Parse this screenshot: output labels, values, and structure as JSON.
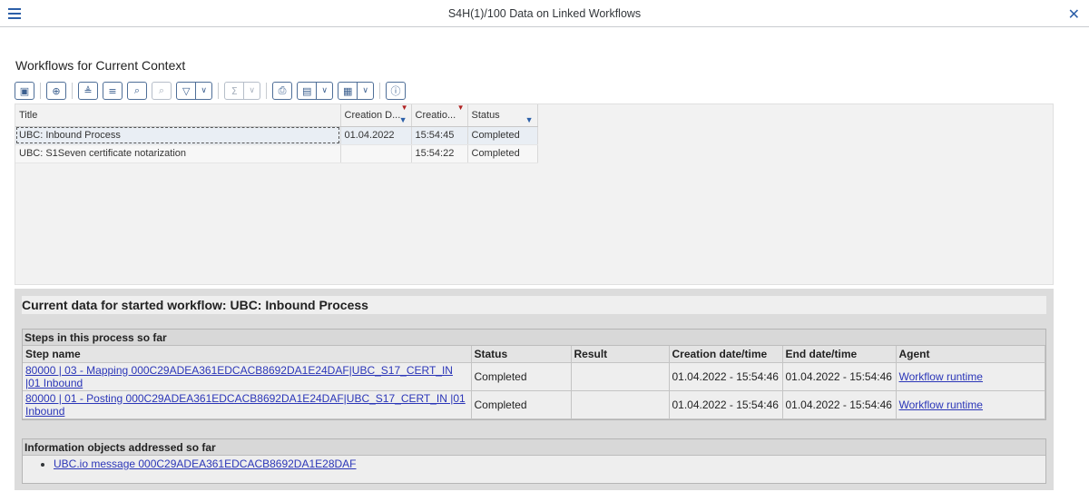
{
  "window": {
    "title": "S4H(1)/100 Data on Linked Workflows",
    "close_glyph": "✕"
  },
  "workflows": {
    "section_title": "Workflows for Current Context",
    "toolbar": {
      "buttons": [
        "details-icon",
        "zoom-icon",
        "sort-ascending-icon",
        "sort-descending-icon",
        "find-icon",
        "find-next-icon",
        "filter-icon",
        "sum-icon",
        "print-icon",
        "export-icon",
        "layout-icon",
        "info-icon"
      ]
    },
    "columns": [
      "Title",
      "Creation D...",
      "Creatio...",
      "Status"
    ],
    "rows": [
      {
        "title": "UBC: Inbound Process",
        "date": "01.04.2022",
        "time": "15:54:45",
        "status": "Completed"
      },
      {
        "title": "UBC: S1Seven certificate notarization",
        "date": "",
        "time": "15:54:22",
        "status": "Completed"
      }
    ]
  },
  "detail": {
    "title": "Current data for started workflow: UBC: Inbound Process",
    "steps_group_title": "Steps in this process so far",
    "step_columns": [
      "Step name",
      "Status",
      "Result",
      "Creation date/time",
      "End date/time",
      "Agent"
    ],
    "steps": [
      {
        "name_line1": "80000 | 03 - Mapping 000C29ADEA361EDCACB8692DA1E24DAF|UBC_S17_CERT_IN",
        "name_line2": "|01 Inbound",
        "status": "Completed",
        "result": "",
        "created": "01.04.2022 - 15:54:46",
        "ended": "01.04.2022 - 15:54:46",
        "agent": "Workflow runtime"
      },
      {
        "name_line1": "80000 | 01 - Posting 000C29ADEA361EDCACB8692DA1E24DAF|UBC_S17_CERT_IN |01",
        "name_line2": "Inbound",
        "status": "Completed",
        "result": "",
        "created": "01.04.2022 - 15:54:46",
        "ended": "01.04.2022 - 15:54:46",
        "agent": "Workflow runtime"
      }
    ],
    "info_group_title": "Information objects addressed so far",
    "info_objects": [
      "UBC.io message 000C29ADEA361EDCACB8692DA1E28DAF"
    ]
  }
}
